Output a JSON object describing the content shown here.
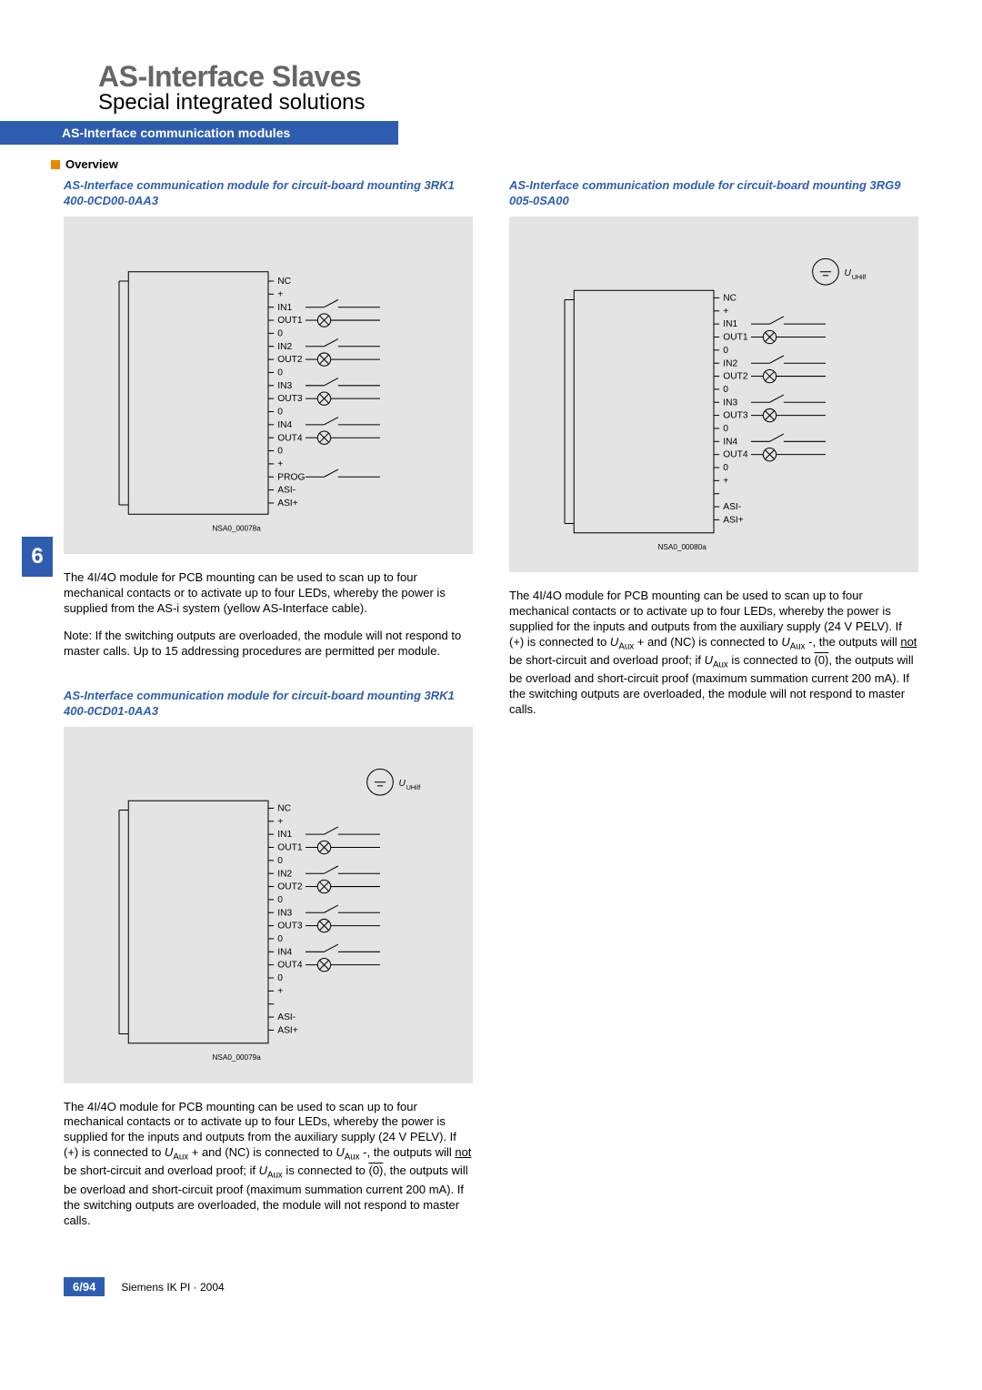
{
  "header": {
    "title_main": "AS-Interface Slaves",
    "title_sub": "Special integrated solutions",
    "blue_bar": "AS-Interface communication modules",
    "overview": "Overview"
  },
  "side_tab": "6",
  "left_col": {
    "sect1": {
      "title": "AS-Interface communication module for circuit-board mounting 3RK1 400-0CD00-0AA3",
      "diag_ref": "NSA0_00078a",
      "para1": "The 4I/4O module for PCB mounting can be used to scan up to four mechanical contacts or to activate up to four LEDs, whereby the power is supplied from the AS-i system (yellow AS-Interface cable).",
      "para2": "Note: If the switching outputs are overloaded, the module will not respond to master calls. Up to 15 addressing procedures are permitted per module."
    },
    "sect2": {
      "title": "AS-Interface communication module for circuit-board mounting 3RK1 400-0CD01-0AA3",
      "diag_ref": "NSA0_00079a",
      "para_html": "The 4I/4O module for PCB mounting can be used to scan up to four mechanical contacts or to activate up to four LEDs, whereby the power is supplied for the inputs and outputs from the auxiliary supply (24 V PELV). If (+) is connected to <i>U</i><sub>Aux</sub> + and (NC) is connected to <i>U</i><sub>Aux</sub> -, the outputs will <u>not</u> be short-circuit and overload proof; if <i>U</i><sub>Aux</sub> is connected to <span class=\"ov\">(0)</span>, the outputs will be overload and short-circuit proof (maximum summation current 200 mA). If the switching outputs are overloaded, the module will not respond to master calls."
    }
  },
  "right_col": {
    "sect1": {
      "title": "AS-Interface communication module for circuit-board mounting 3RG9 005-0SA00",
      "diag_ref": "NSA0_00080a",
      "para_html": "The 4I/4O module for PCB mounting can be used to scan up to four mechanical contacts or to activate up to four LEDs, whereby the power is supplied for the inputs and outputs from the auxiliary supply (24 V PELV). If (+) is connected to <i>U</i><sub>Aux</sub> + and (NC) is connected to <i>U</i><sub>Aux</sub> -, the outputs will <u>not</u> be short-circuit and overload proof; if <i>U</i><sub>Aux</sub> is connected to <span class=\"ov\">(0)</span>, the outputs will be overload and short-circuit proof (maximum summation current 200 mA). If the switching outputs are overloaded, the module will not respond to master calls."
    }
  },
  "diagram_labels": {
    "nc": "NC",
    "plus": "+",
    "in1": "IN1",
    "out1": "OUT1",
    "zero": "0",
    "in2": "IN2",
    "out2": "OUT2",
    "in3": "IN3",
    "out3": "OUT3",
    "in4": "IN4",
    "out4": "OUT4",
    "prog": "PROG",
    "asi_minus": "ASI-",
    "asi_plus": "ASI+",
    "u_hilf": "UHilf"
  },
  "footer": {
    "page": "6/94",
    "ref": "Siemens IK PI · 2004"
  }
}
